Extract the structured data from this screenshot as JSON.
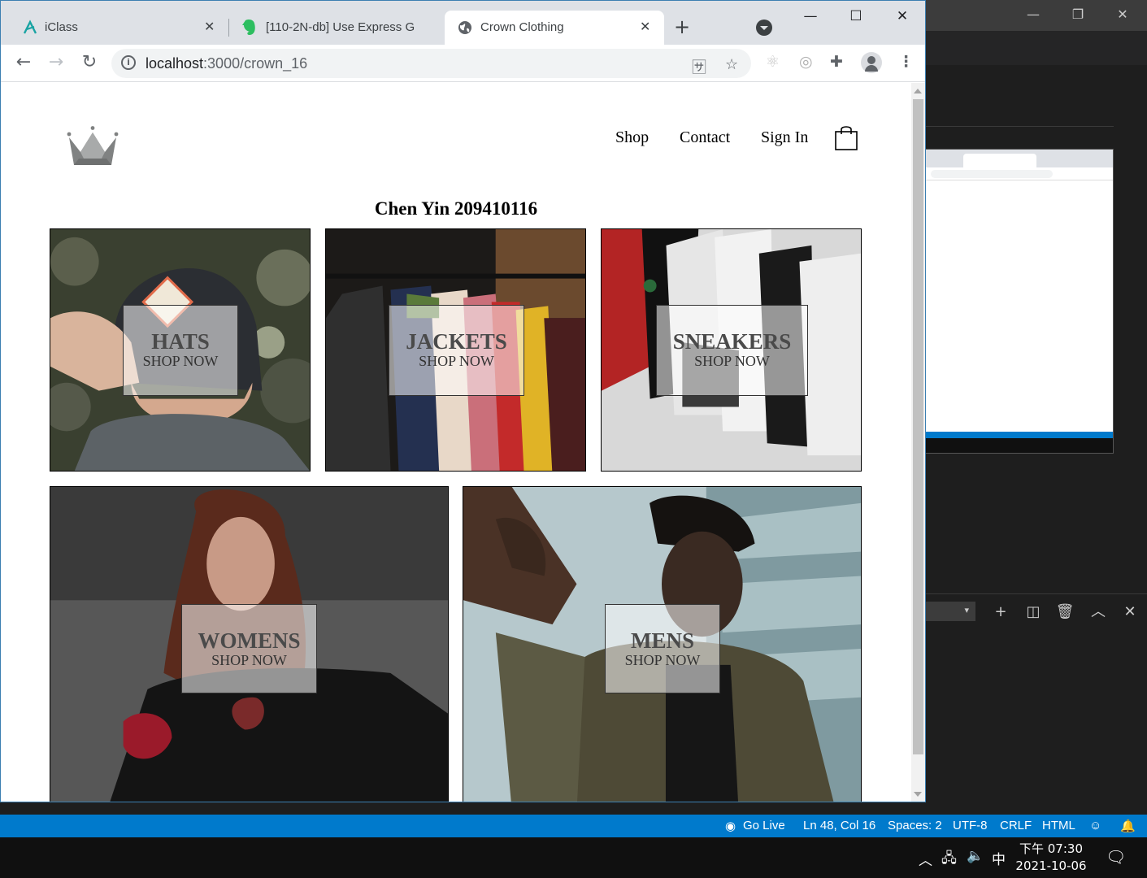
{
  "browser": {
    "tabs": [
      {
        "title": "iClass",
        "active": false
      },
      {
        "title": "[110-2N-db] Use Express G",
        "active": false
      },
      {
        "title": "Crown Clothing",
        "active": true
      }
    ],
    "url": {
      "host": "localhost",
      "path": ":3000/crown_16"
    }
  },
  "page": {
    "nav": {
      "shop": "Shop",
      "contact": "Contact",
      "sign_in": "Sign In"
    },
    "heading": "Chen Yin 209410116",
    "categories": [
      {
        "title": "HATS",
        "subtitle": "SHOP NOW"
      },
      {
        "title": "JACKETS",
        "subtitle": "SHOP NOW"
      },
      {
        "title": "SNEAKERS",
        "subtitle": "SHOP NOW"
      },
      {
        "title": "WOMENS",
        "subtitle": "SHOP NOW"
      },
      {
        "title": "MENS",
        "subtitle": "SHOP NOW"
      }
    ]
  },
  "vscode": {
    "status_bar": {
      "go_live": "Go Live",
      "position": "Ln 48, Col 16",
      "spaces": "Spaces: 2",
      "encoding": "UTF-8",
      "eol": "CRLF",
      "language": "HTML"
    }
  },
  "taskbar": {
    "ime": "中",
    "time": "下午 07:30",
    "date": "2021-10-06"
  }
}
